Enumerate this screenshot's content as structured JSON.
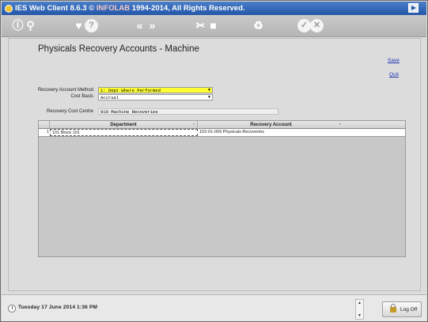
{
  "window": {
    "title_app": "IES Web Client 8.6.3",
    "title_copyright": "©",
    "title_brand": "INFOLAB",
    "title_rest": "1994-2014, All Rights Reserved."
  },
  "toolbar": {
    "icons": [
      "info-icon",
      "search-icon",
      "heart-icon",
      "question-icon",
      "first-icon",
      "last-icon",
      "tools-icon",
      "square-icon",
      "recycle-icon",
      "check-icon",
      "cancel-icon"
    ]
  },
  "page": {
    "title": "Physicals Recovery Accounts - Machine",
    "save_label": "Save",
    "quit_label": "Quit"
  },
  "form": {
    "method_label": "Recovery Account Method",
    "method_value": "1: Dept Where Performed",
    "cost_basis_label": "Cost Basis",
    "cost_basis_value": "Accrual",
    "cost_centre_label": "Recovery Cost Centre",
    "cost_centre_value": "910 Machine Recoveries"
  },
  "grid": {
    "columns": [
      "Department",
      "Recovery Account"
    ],
    "rows": [
      {
        "num": "1",
        "department": "101 Block 101",
        "account": "102-01-009 Physicals Recoveries"
      }
    ]
  },
  "status": {
    "date": "Tuesday 17 June 2014 1:36 PM",
    "logoff_label": "Log Off"
  },
  "colors": {
    "highlight": "#ffff33",
    "titlebar": "#2456a8",
    "link": "#1c35b8"
  }
}
